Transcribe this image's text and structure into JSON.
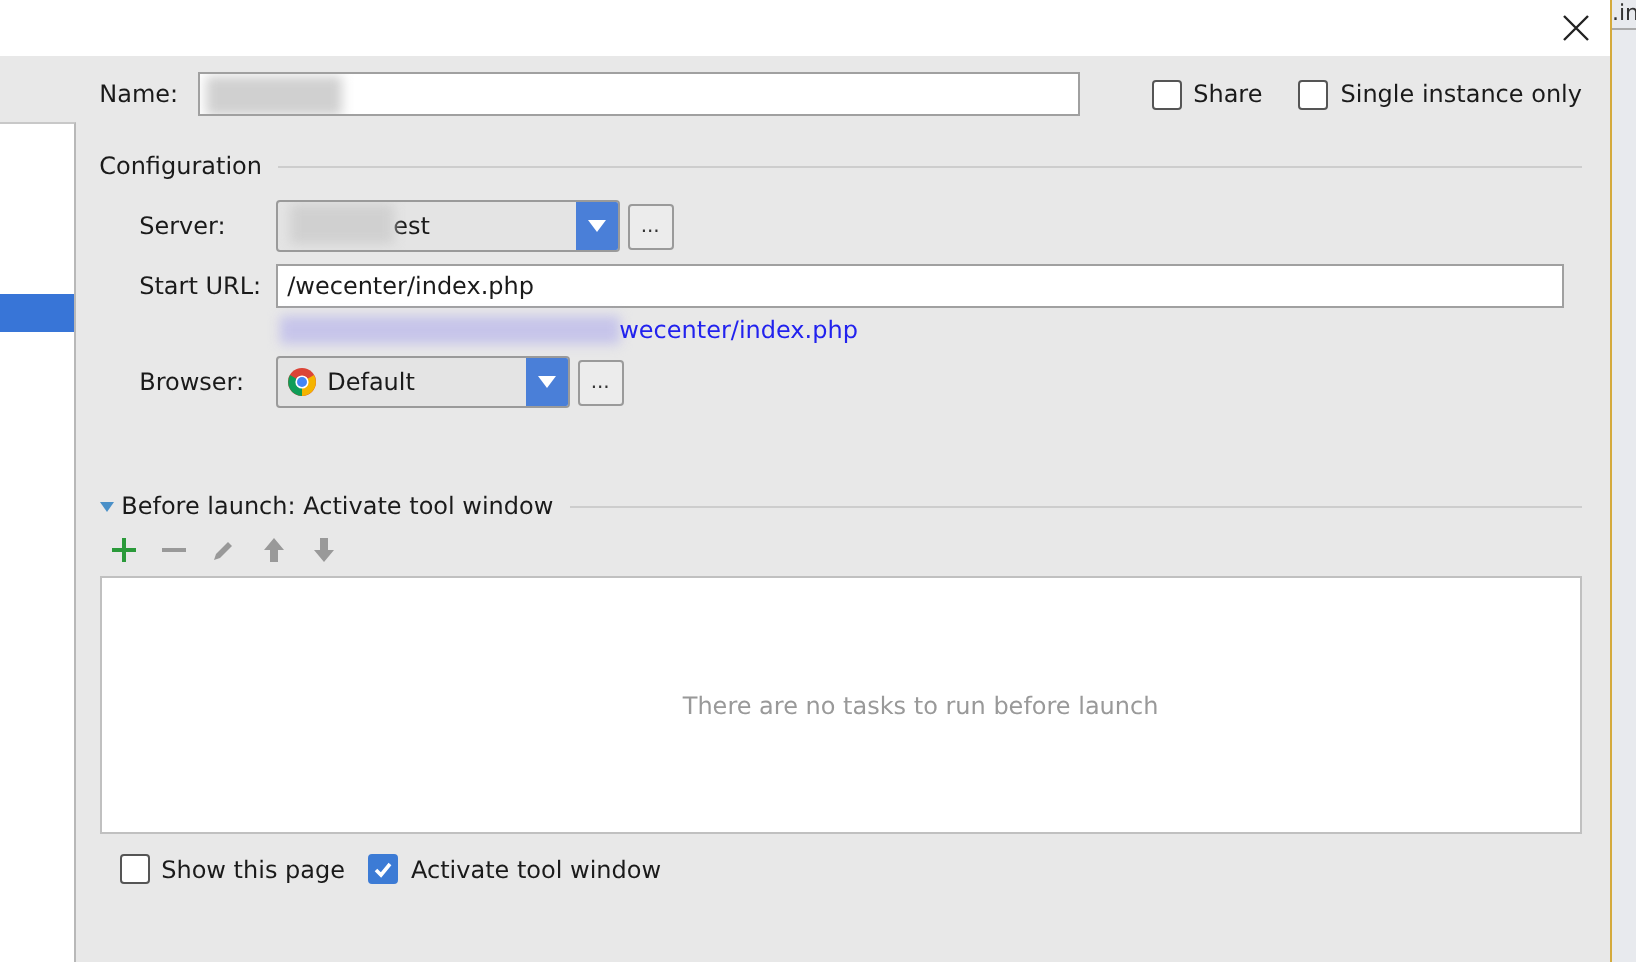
{
  "background_window": {
    "fragment": ".in"
  },
  "name": {
    "label": "Name:"
  },
  "options": [
    {
      "label": "Share",
      "checked": false
    },
    {
      "label": "Single instance only",
      "checked": false
    }
  ],
  "configuration": {
    "title": "Configuration",
    "server": {
      "label": "Server:",
      "value": "est",
      "button": "..."
    },
    "start_url": {
      "label": "Start URL:",
      "value": "/wecenter/index.php"
    },
    "url_link": "wecenter/index.php",
    "browser": {
      "label": "Browser:",
      "value": "Default",
      "button": "..."
    }
  },
  "sidebar": {
    "items": [
      {
        "selected": true
      }
    ]
  },
  "before_launch": {
    "title": "Before launch: Activate tool window",
    "expanded": true,
    "empty_text": "There are no tasks to run before launch"
  },
  "bottom_options": [
    {
      "label": "Show this page",
      "checked": false
    },
    {
      "label": "Activate tool window",
      "checked": true
    }
  ]
}
